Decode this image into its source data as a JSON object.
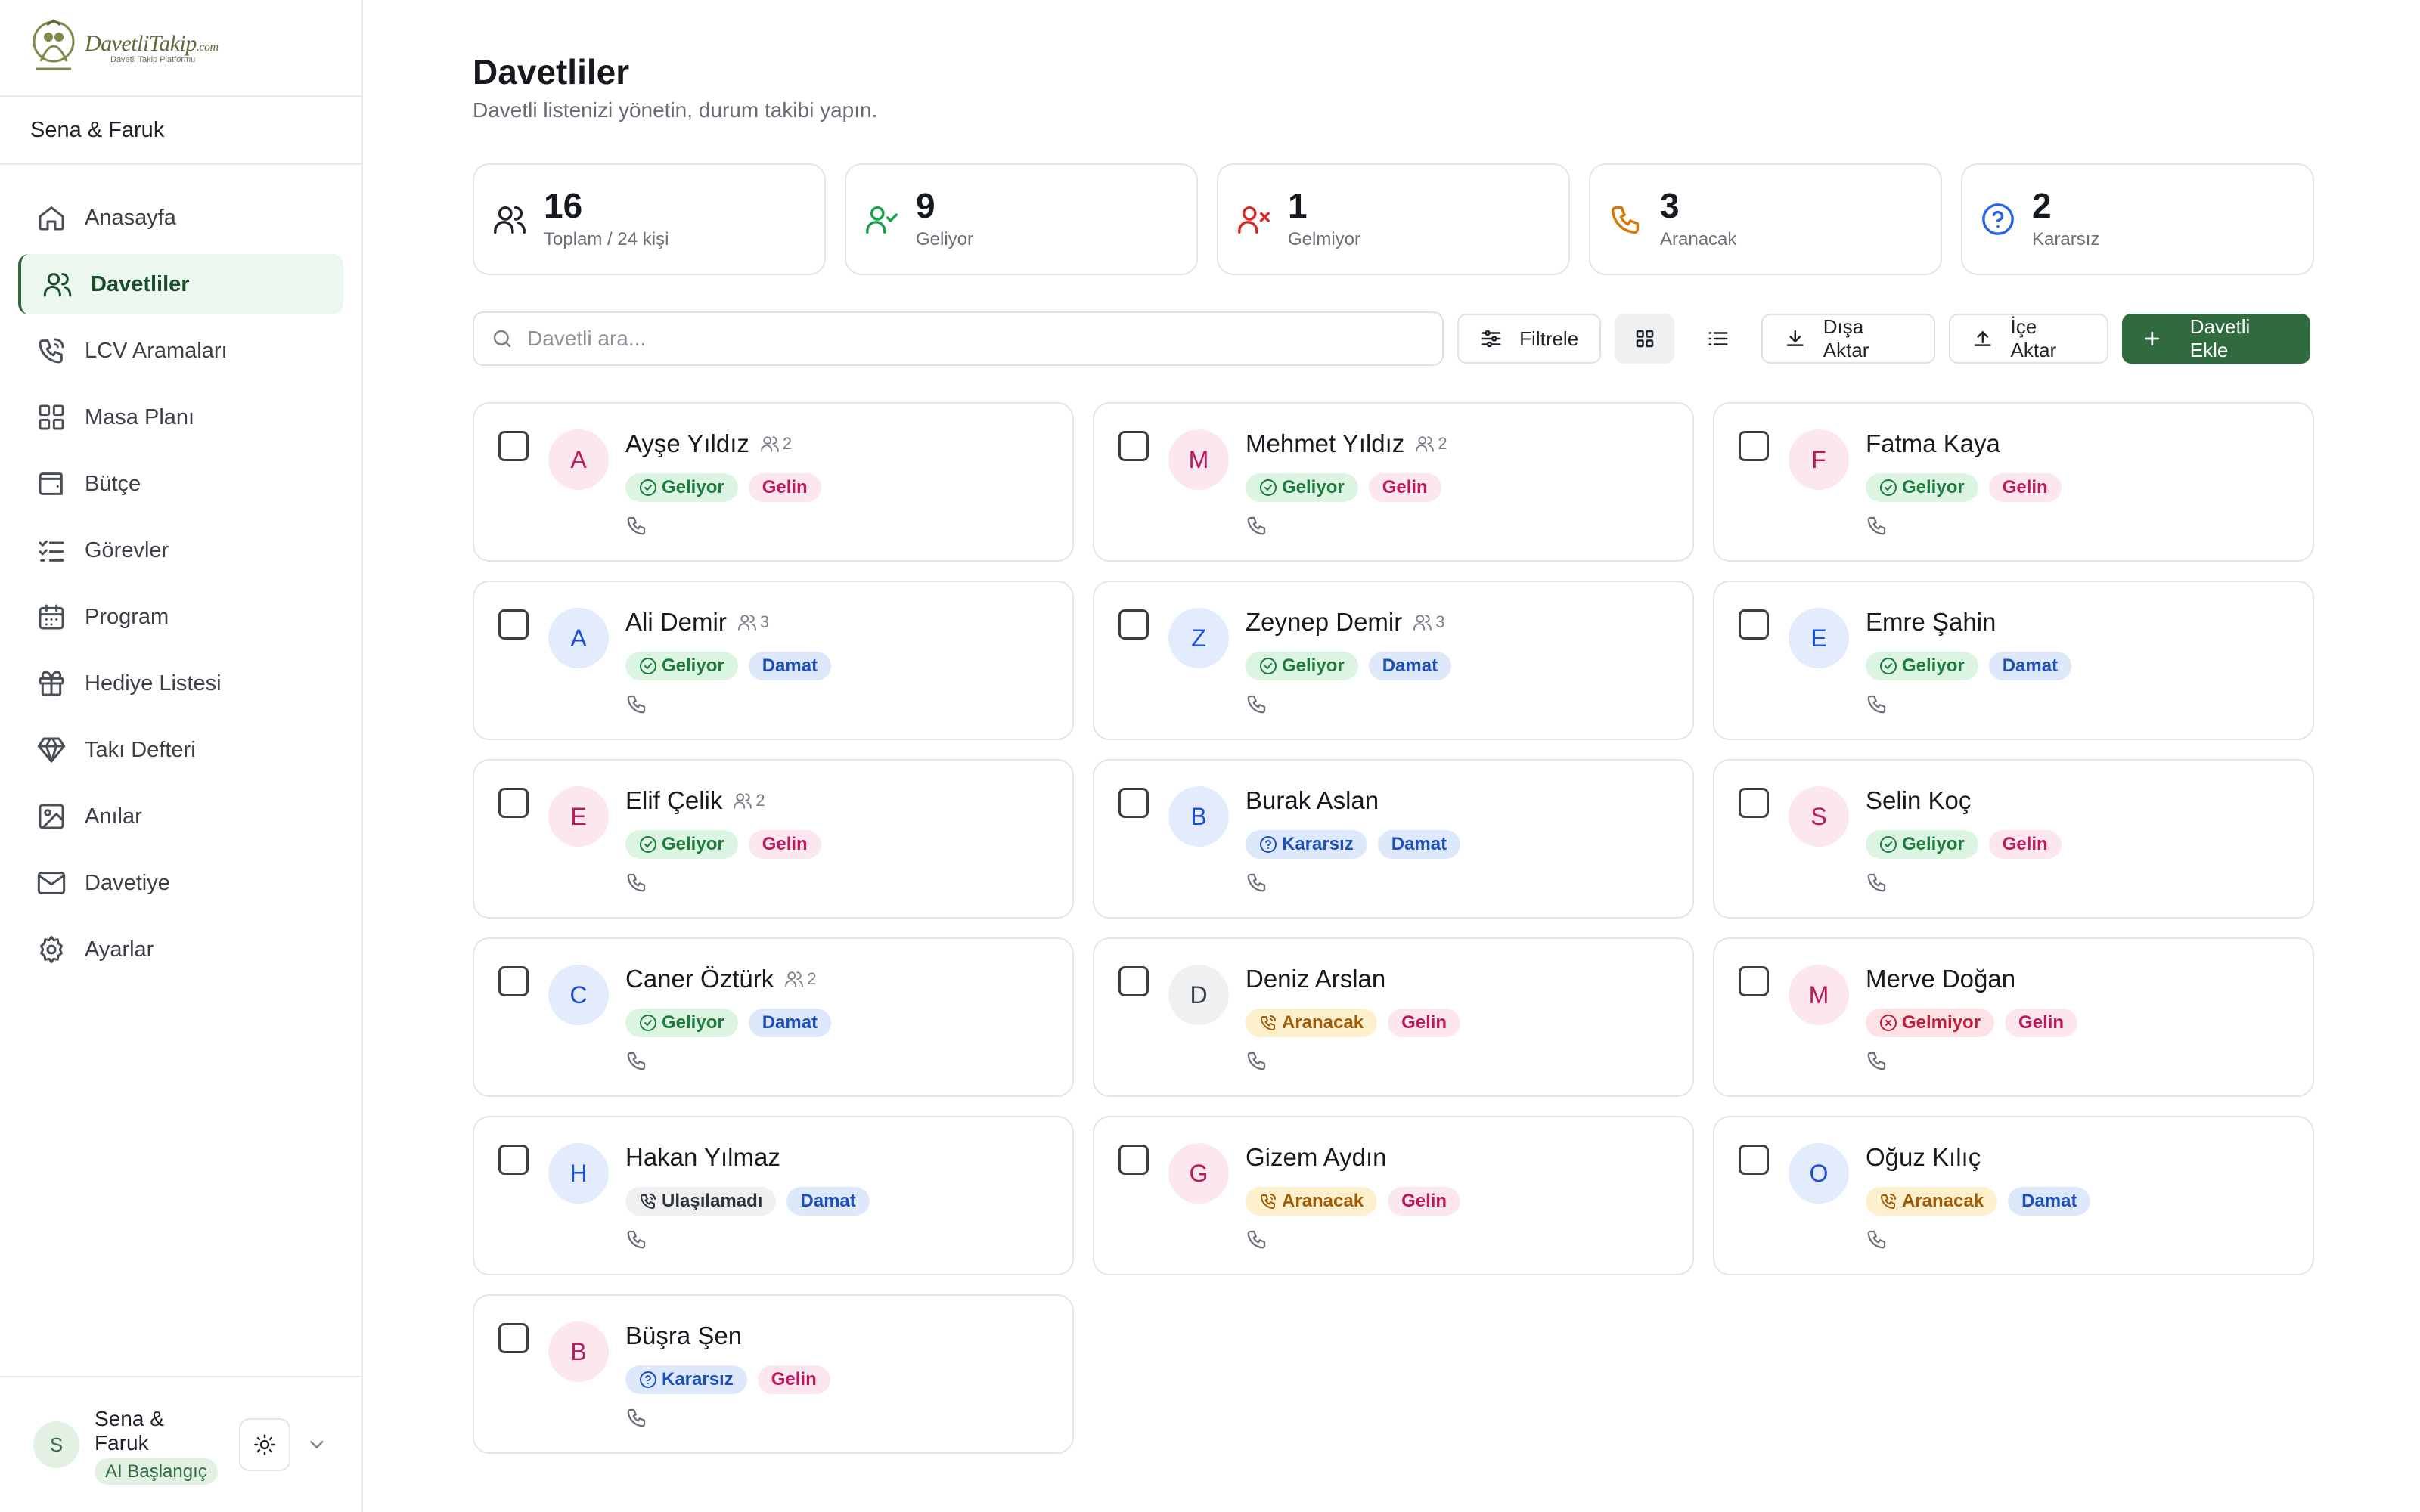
{
  "brand": {
    "name": "DavetliTakip",
    "suffix": ".com",
    "tagline": "Davetli Takip Platformu"
  },
  "couple": "Sena & Faruk",
  "nav": [
    {
      "label": "Anasayfa",
      "icon": "home-icon",
      "active": false
    },
    {
      "label": "Davetliler",
      "icon": "users-icon",
      "active": true
    },
    {
      "label": "LCV Aramaları",
      "icon": "phone-call-icon",
      "active": false
    },
    {
      "label": "Masa Planı",
      "icon": "grid-icon",
      "active": false
    },
    {
      "label": "Bütçe",
      "icon": "wallet-icon",
      "active": false
    },
    {
      "label": "Görevler",
      "icon": "checklist-icon",
      "active": false
    },
    {
      "label": "Program",
      "icon": "calendar-icon",
      "active": false
    },
    {
      "label": "Hediye Listesi",
      "icon": "gift-icon",
      "active": false
    },
    {
      "label": "Takı Defteri",
      "icon": "diamond-icon",
      "active": false
    },
    {
      "label": "Anılar",
      "icon": "image-icon",
      "active": false
    },
    {
      "label": "Davetiye",
      "icon": "mail-icon",
      "active": false
    },
    {
      "label": "Ayarlar",
      "icon": "settings-icon",
      "active": false
    }
  ],
  "user": {
    "initial": "S",
    "name": "Sena & Faruk",
    "plan": "AI Başlangıç"
  },
  "page": {
    "title": "Davetliler",
    "subtitle": "Davetli listenizi yönetin, durum takibi yapın."
  },
  "stats": [
    {
      "value": "16",
      "label": "Toplam / 24 kişi",
      "icon": "users-icon",
      "color": "#1f2329"
    },
    {
      "value": "9",
      "label": "Geliyor",
      "icon": "user-check-icon",
      "color": "#16a34a"
    },
    {
      "value": "1",
      "label": "Gelmiyor",
      "icon": "user-x-icon",
      "color": "#dc2626"
    },
    {
      "value": "3",
      "label": "Aranacak",
      "icon": "phone-icon",
      "color": "#d97706"
    },
    {
      "value": "2",
      "label": "Kararsız",
      "icon": "help-circle-icon",
      "color": "#2563eb"
    }
  ],
  "toolbar": {
    "search_placeholder": "Davetli ara...",
    "filter": "Filtrele",
    "export": "Dışa Aktar",
    "import": "İçe Aktar",
    "add": "Davetli Ekle"
  },
  "colors": {
    "accent": "#2f6b3e",
    "accent_light": "#ecf7ee"
  },
  "guests": [
    {
      "initial": "A",
      "name": "Ayşe Yıldız",
      "party": "2",
      "status": "Geliyor",
      "side": "Gelin"
    },
    {
      "initial": "M",
      "name": "Mehmet Yıldız",
      "party": "2",
      "status": "Geliyor",
      "side": "Gelin"
    },
    {
      "initial": "F",
      "name": "Fatma Kaya",
      "party": "",
      "status": "Geliyor",
      "side": "Gelin"
    },
    {
      "initial": "A",
      "name": "Ali Demir",
      "party": "3",
      "status": "Geliyor",
      "side": "Damat"
    },
    {
      "initial": "Z",
      "name": "Zeynep Demir",
      "party": "3",
      "status": "Geliyor",
      "side": "Damat"
    },
    {
      "initial": "E",
      "name": "Emre Şahin",
      "party": "",
      "status": "Geliyor",
      "side": "Damat"
    },
    {
      "initial": "E",
      "name": "Elif Çelik",
      "party": "2",
      "status": "Geliyor",
      "side": "Gelin"
    },
    {
      "initial": "B",
      "name": "Burak Aslan",
      "party": "",
      "status": "Kararsız",
      "side": "Damat"
    },
    {
      "initial": "S",
      "name": "Selin Koç",
      "party": "",
      "status": "Geliyor",
      "side": "Gelin"
    },
    {
      "initial": "C",
      "name": "Caner Öztürk",
      "party": "2",
      "status": "Geliyor",
      "side": "Damat"
    },
    {
      "initial": "D",
      "name": "Deniz Arslan",
      "party": "",
      "status": "Aranacak",
      "side": "Gelin"
    },
    {
      "initial": "M",
      "name": "Merve Doğan",
      "party": "",
      "status": "Gelmiyor",
      "side": "Gelin"
    },
    {
      "initial": "H",
      "name": "Hakan Yılmaz",
      "party": "",
      "status": "Ulaşılamadı",
      "side": "Damat"
    },
    {
      "initial": "G",
      "name": "Gizem Aydın",
      "party": "",
      "status": "Aranacak",
      "side": "Gelin"
    },
    {
      "initial": "O",
      "name": "Oğuz Kılıç",
      "party": "",
      "status": "Aranacak",
      "side": "Damat"
    },
    {
      "initial": "B",
      "name": "Büşra Şen",
      "party": "",
      "status": "Kararsız",
      "side": "Gelin"
    }
  ]
}
